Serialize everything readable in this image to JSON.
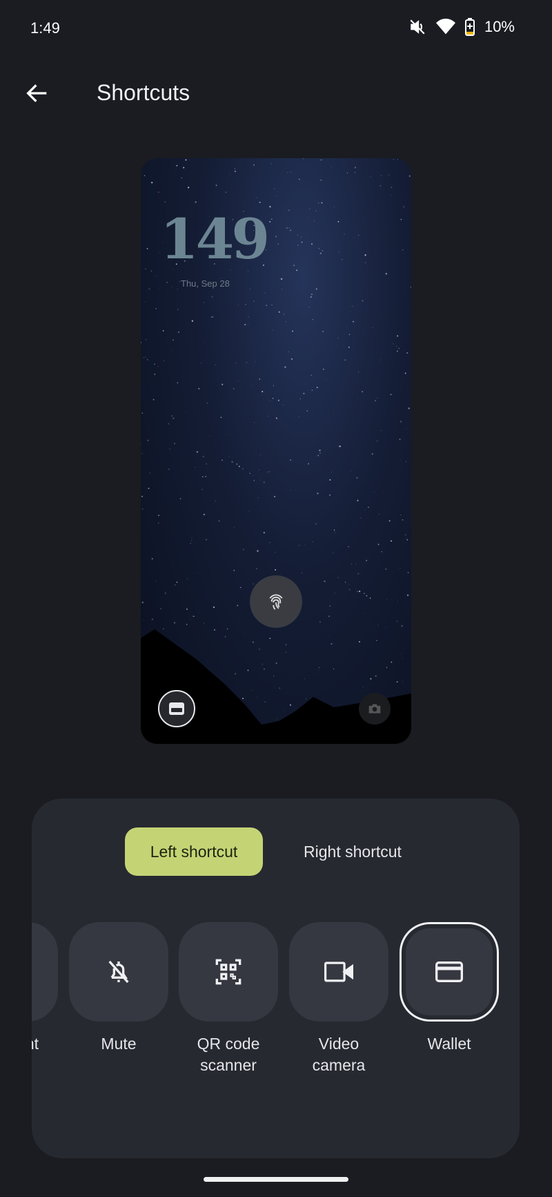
{
  "status_bar": {
    "time": "1:49",
    "battery": "10%",
    "icons": [
      "mute-vibrate-off-icon",
      "wifi-icon",
      "battery-charging-icon"
    ]
  },
  "header": {
    "title": "Shortcuts",
    "back_icon": "arrow-back-icon"
  },
  "preview": {
    "clock": "149",
    "date": "Thu, Sep 28",
    "left_shortcut_icon": "wallet-icon",
    "right_shortcut_icon": "camera-icon"
  },
  "panel": {
    "tabs": [
      {
        "label": "Left shortcut",
        "selected": true
      },
      {
        "label": "Right shortcut",
        "selected": false
      }
    ],
    "accent": "#c4d475",
    "options": [
      {
        "label": "nt",
        "icon": "unknown-icon",
        "selected": false
      },
      {
        "label": "Mute",
        "icon": "bell-off-icon",
        "selected": false
      },
      {
        "label": "QR code scanner",
        "line1": "QR code",
        "line2": "scanner",
        "icon": "qr-code-scanner-icon",
        "selected": false
      },
      {
        "label": "Video camera",
        "line1": "Video",
        "line2": "camera",
        "icon": "video-camera-icon",
        "selected": false
      },
      {
        "label": "Wallet",
        "icon": "wallet-icon",
        "selected": true
      }
    ]
  }
}
